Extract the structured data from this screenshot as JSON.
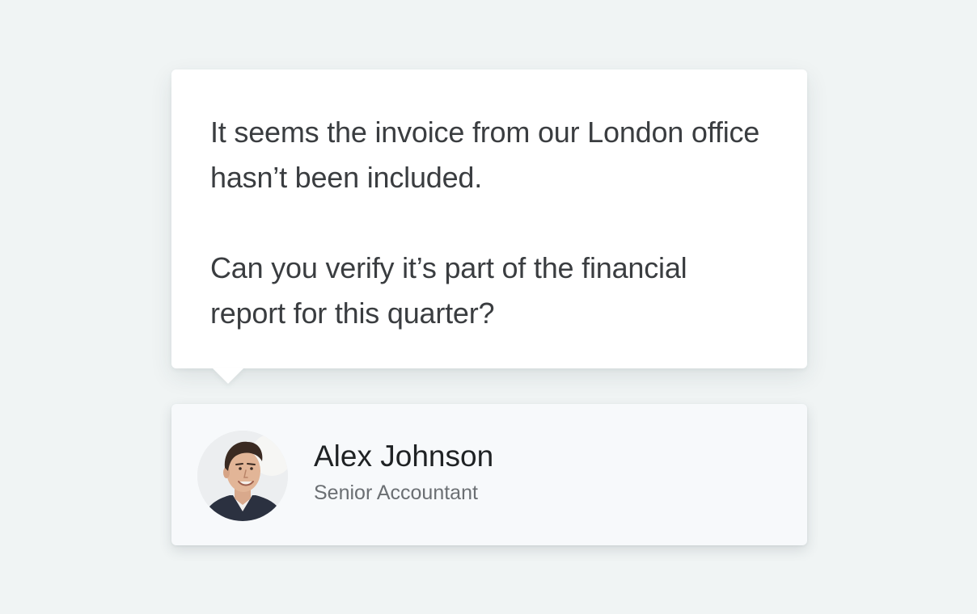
{
  "message": {
    "paragraphs": [
      "It seems the invoice from our London office hasn’t been included.",
      "Can you verify it’s part of the financial report for this quarter?"
    ]
  },
  "author": {
    "name": "Alex Johnson",
    "role": "Senior Accountant",
    "avatar_icon": "person-photo-avatar"
  },
  "colors": {
    "background": "#f0f4f4",
    "bubble": "#ffffff",
    "card": "#f7f9fb",
    "message_text": "#3a3d40",
    "name_text": "#1f2224",
    "role_text": "#6b6f73"
  }
}
